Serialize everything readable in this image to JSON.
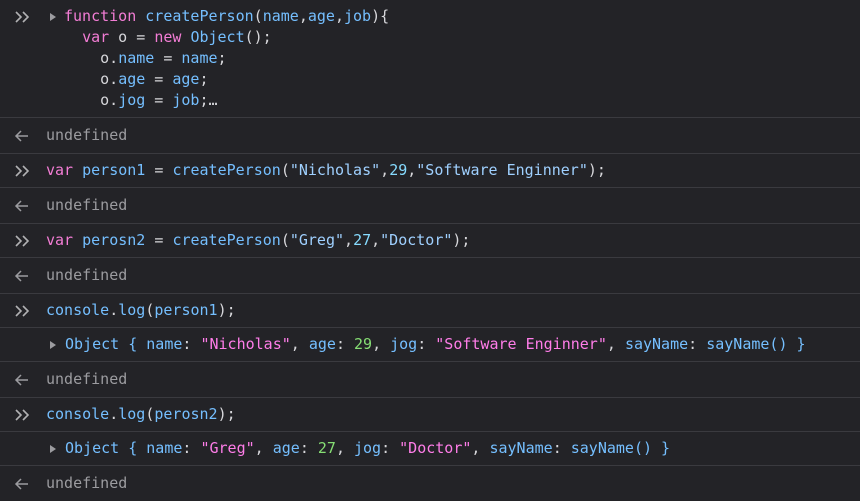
{
  "entries": [
    {
      "type": "input",
      "expandable": true,
      "lines": [
        [
          {
            "t": "function",
            "c": "tw"
          },
          {
            "t": " ",
            "c": "pl"
          },
          {
            "t": "createPerson",
            "c": "fn"
          },
          {
            "t": "(",
            "c": "pl"
          },
          {
            "t": "name",
            "c": "fn"
          },
          {
            "t": ",",
            "c": "pl"
          },
          {
            "t": "age",
            "c": "fn"
          },
          {
            "t": ",",
            "c": "pl"
          },
          {
            "t": "job",
            "c": "fn"
          },
          {
            "t": "){",
            "c": "pl"
          }
        ],
        [
          {
            "t": "  ",
            "c": "pl"
          },
          {
            "t": "var",
            "c": "tw"
          },
          {
            "t": " o = ",
            "c": "pl"
          },
          {
            "t": "new",
            "c": "tw"
          },
          {
            "t": " ",
            "c": "pl"
          },
          {
            "t": "Object",
            "c": "fn"
          },
          {
            "t": "();",
            "c": "pl"
          }
        ],
        [
          {
            "t": "    o.",
            "c": "pl"
          },
          {
            "t": "name",
            "c": "fn"
          },
          {
            "t": " = ",
            "c": "pl"
          },
          {
            "t": "name",
            "c": "fn"
          },
          {
            "t": ";",
            "c": "pl"
          }
        ],
        [
          {
            "t": "    o.",
            "c": "pl"
          },
          {
            "t": "age",
            "c": "fn"
          },
          {
            "t": " = ",
            "c": "pl"
          },
          {
            "t": "age",
            "c": "fn"
          },
          {
            "t": ";",
            "c": "pl"
          }
        ],
        [
          {
            "t": "    o.",
            "c": "pl"
          },
          {
            "t": "jog",
            "c": "fn"
          },
          {
            "t": " = ",
            "c": "pl"
          },
          {
            "t": "job",
            "c": "fn"
          },
          {
            "t": ";…",
            "c": "pl"
          }
        ]
      ]
    },
    {
      "type": "result",
      "text": "undefined"
    },
    {
      "type": "input",
      "lines": [
        [
          {
            "t": "var",
            "c": "tw"
          },
          {
            "t": " ",
            "c": "pl"
          },
          {
            "t": "person1",
            "c": "fn"
          },
          {
            "t": " = ",
            "c": "pl"
          },
          {
            "t": "createPerson",
            "c": "fn"
          },
          {
            "t": "(",
            "c": "pl"
          },
          {
            "t": "\"Nicholas\"",
            "c": "st"
          },
          {
            "t": ",",
            "c": "pl"
          },
          {
            "t": "29",
            "c": "nm"
          },
          {
            "t": ",",
            "c": "pl"
          },
          {
            "t": "\"Software Enginner\"",
            "c": "st"
          },
          {
            "t": ");",
            "c": "pl"
          }
        ]
      ]
    },
    {
      "type": "result",
      "text": "undefined"
    },
    {
      "type": "input",
      "lines": [
        [
          {
            "t": "var",
            "c": "tw"
          },
          {
            "t": " ",
            "c": "pl"
          },
          {
            "t": "perosn2",
            "c": "fn"
          },
          {
            "t": " = ",
            "c": "pl"
          },
          {
            "t": "createPerson",
            "c": "fn"
          },
          {
            "t": "(",
            "c": "pl"
          },
          {
            "t": "\"Greg\"",
            "c": "st"
          },
          {
            "t": ",",
            "c": "pl"
          },
          {
            "t": "27",
            "c": "nm"
          },
          {
            "t": ",",
            "c": "pl"
          },
          {
            "t": "\"Doctor\"",
            "c": "st"
          },
          {
            "t": ");",
            "c": "pl"
          }
        ]
      ]
    },
    {
      "type": "result",
      "text": "undefined"
    },
    {
      "type": "input",
      "lines": [
        [
          {
            "t": "console",
            "c": "fn"
          },
          {
            "t": ".",
            "c": "pl"
          },
          {
            "t": "log",
            "c": "fn"
          },
          {
            "t": "(",
            "c": "pl"
          },
          {
            "t": "person1",
            "c": "fn"
          },
          {
            "t": ");",
            "c": "pl"
          }
        ]
      ]
    },
    {
      "type": "log",
      "lines": [
        [
          {
            "t": "Object",
            "c": "ok"
          },
          {
            "t": " { ",
            "c": "okey"
          },
          {
            "t": "name",
            "c": "okey"
          },
          {
            "t": ": ",
            "c": "pl"
          },
          {
            "t": "\"Nicholas\"",
            "c": "ostr"
          },
          {
            "t": ", ",
            "c": "pl"
          },
          {
            "t": "age",
            "c": "okey"
          },
          {
            "t": ": ",
            "c": "pl"
          },
          {
            "t": "29",
            "c": "onum"
          },
          {
            "t": ", ",
            "c": "pl"
          },
          {
            "t": "jog",
            "c": "okey"
          },
          {
            "t": ": ",
            "c": "pl"
          },
          {
            "t": "\"Software Enginner\"",
            "c": "ostr"
          },
          {
            "t": ", ",
            "c": "pl"
          },
          {
            "t": "sayName",
            "c": "okey"
          },
          {
            "t": ": ",
            "c": "pl"
          },
          {
            "t": "sayName()",
            "c": "okey"
          },
          {
            "t": " }",
            "c": "okey"
          }
        ]
      ]
    },
    {
      "type": "result",
      "text": "undefined"
    },
    {
      "type": "input",
      "lines": [
        [
          {
            "t": "console",
            "c": "fn"
          },
          {
            "t": ".",
            "c": "pl"
          },
          {
            "t": "log",
            "c": "fn"
          },
          {
            "t": "(",
            "c": "pl"
          },
          {
            "t": "perosn2",
            "c": "fn"
          },
          {
            "t": ");",
            "c": "pl"
          }
        ]
      ]
    },
    {
      "type": "log",
      "lines": [
        [
          {
            "t": "Object",
            "c": "ok"
          },
          {
            "t": " { ",
            "c": "okey"
          },
          {
            "t": "name",
            "c": "okey"
          },
          {
            "t": ": ",
            "c": "pl"
          },
          {
            "t": "\"Greg\"",
            "c": "ostr"
          },
          {
            "t": ", ",
            "c": "pl"
          },
          {
            "t": "age",
            "c": "okey"
          },
          {
            "t": ": ",
            "c": "pl"
          },
          {
            "t": "27",
            "c": "onum"
          },
          {
            "t": ", ",
            "c": "pl"
          },
          {
            "t": "jog",
            "c": "okey"
          },
          {
            "t": ": ",
            "c": "pl"
          },
          {
            "t": "\"Doctor\"",
            "c": "ostr"
          },
          {
            "t": ", ",
            "c": "pl"
          },
          {
            "t": "sayName",
            "c": "okey"
          },
          {
            "t": ": ",
            "c": "pl"
          },
          {
            "t": "sayName()",
            "c": "okey"
          },
          {
            "t": " }",
            "c": "okey"
          }
        ]
      ]
    },
    {
      "type": "result",
      "text": "undefined"
    }
  ]
}
